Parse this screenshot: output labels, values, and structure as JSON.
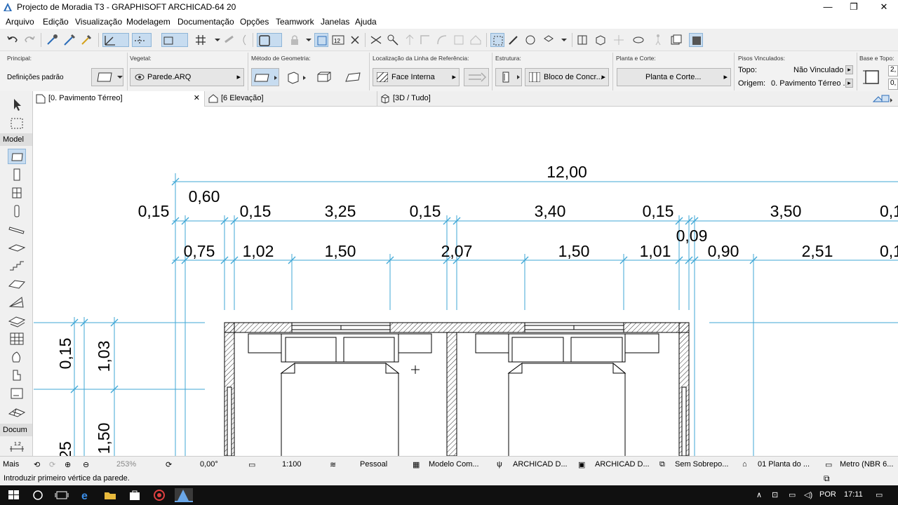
{
  "window": {
    "title": "Projecto de Moradia T3 - GRAPHISOFT ARCHICAD-64 20",
    "minimize": "—",
    "restore": "❐",
    "close": "✕"
  },
  "menu": [
    "Arquivo",
    "Edição",
    "Visualização",
    "Modelagem",
    "Documentação",
    "Opções",
    "Teamwork",
    "Janelas",
    "Ajuda"
  ],
  "infobox": {
    "principal_label": "Principal:",
    "principal_value": "Definições padrão",
    "vegetal_label": "Vegetal:",
    "vegetal_value": "Parede.ARQ",
    "geometry_label": "Método de Geometria:",
    "refline_label": "Localização da Linha de Referência:",
    "refline_value": "Face Interna",
    "structure_label": "Estrutura:",
    "structure_value": "Bloco de Concr...",
    "plan_label": "Planta e Corte:",
    "plan_value": "Planta e Corte...",
    "floors_label": "Pisos Vinculados:",
    "top_label": "Topo:",
    "top_value": "Não Vinculado",
    "origin_label": "Origem:",
    "origin_value": "0. Pavimento Térreo ...",
    "base_label": "Base e Topo:",
    "base_val1": "2,",
    "base_val2": "0,"
  },
  "tabs": [
    {
      "label": "[0. Pavimento Térreo]"
    },
    {
      "label": "[6 Elevação]"
    },
    {
      "label": "[3D / Tudo]"
    }
  ],
  "toolbox": {
    "model_header": "Model",
    "docu_header": "Docum",
    "more": "Mais"
  },
  "dimensions": {
    "overall": "12,00",
    "row1": [
      "0,15",
      "0,60",
      "0,15",
      "3,25",
      "0,15",
      "3,40",
      "0,15",
      "3,50",
      "0,1"
    ],
    "row1_extra": "0,09",
    "row2": [
      "0,75",
      "1,02",
      "1,50",
      "2,07",
      "1,50",
      "1,01",
      "0,90",
      "2,51",
      "0,1"
    ],
    "left_vertical": [
      "0,15",
      "1,03",
      "1,50",
      "25"
    ]
  },
  "statusbar": {
    "zoom": "253%",
    "angle": "0,00°",
    "scale": "1:100",
    "layers": "Pessoal",
    "model_view": "Modelo Com...",
    "pen": "ARCHICAD D...",
    "dim": "ARCHICAD D...",
    "override": "Sem Sobrepo...",
    "renovation": "01 Planta do ...",
    "units": "Metro (NBR 6..."
  },
  "hint": "Introduzir primeiro vértice da parede.",
  "taskbar": {
    "language": "POR",
    "time": "17:11"
  },
  "colors": {
    "dimension": "#3fa7d6",
    "selection": "#c7dcf0",
    "taskbar": "#101010"
  }
}
